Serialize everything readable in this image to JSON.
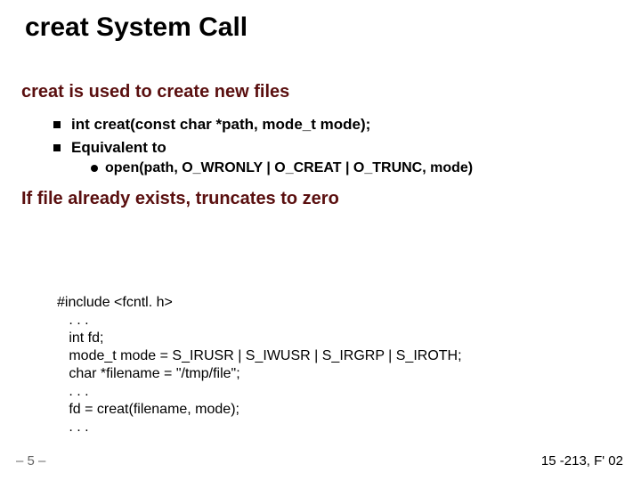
{
  "title": "creat System Call",
  "sub1a": "creat is used to create new files",
  "bullets1": {
    "a": "int creat(const char *path, mode_t mode);",
    "b": "Equivalent to"
  },
  "bullet2": "open(path, O_WRONLY | O_CREAT | O_TRUNC, mode)",
  "sub1b": "If file already exists, truncates to zero",
  "code": {
    "l1": "#include <fcntl. h>",
    "l2": "   . . .",
    "l3": "   int fd;",
    "l4": "   mode_t mode = S_IRUSR | S_IWUSR | S_IRGRP | S_IROTH;",
    "l5": "   char *filename = \"/tmp/file\";",
    "l6": "   . . .",
    "l7": "   fd = creat(filename, mode);",
    "l8": "   . . ."
  },
  "footer": {
    "page": "– 5 –",
    "course": "15 -213, F' 02"
  }
}
